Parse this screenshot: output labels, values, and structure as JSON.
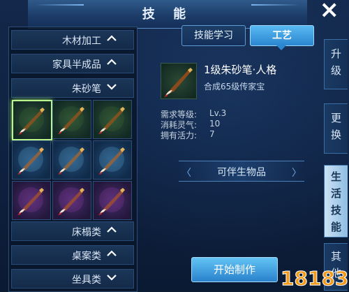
{
  "title": "技 能",
  "close_icon": "×",
  "left_list": {
    "categories": [
      {
        "label": "木材加工",
        "state": "collapsed"
      },
      {
        "label": "家具半成品",
        "state": "collapsed"
      },
      {
        "label": "朱砂笔",
        "state": "expanded"
      },
      {
        "label": "床榻类",
        "state": "collapsed"
      },
      {
        "label": "桌案类",
        "state": "collapsed"
      },
      {
        "label": "坐具类",
        "state": "collapsed"
      }
    ],
    "item_rows": [
      {
        "color": "green"
      },
      {
        "color": "blue"
      },
      {
        "color": "purple"
      }
    ]
  },
  "tabs": {
    "skill_learn": "技能学习",
    "craft": "工艺"
  },
  "item": {
    "name": "1级朱砂笔·人格",
    "subtitle": "合成65级传家宝"
  },
  "stats": [
    {
      "label": "需求等级:",
      "value": "Lv.3"
    },
    {
      "label": "消耗灵气:",
      "value": "10"
    },
    {
      "label": "拥有活力:",
      "value": "7"
    }
  ],
  "section_label": "可伴生物品",
  "start_button": "开始制作",
  "side_tabs": [
    {
      "label": [
        "升",
        "级"
      ],
      "active": false
    },
    {
      "label": [
        "更",
        "换"
      ],
      "active": false
    },
    {
      "label": [
        "生",
        "活",
        "技",
        "能"
      ],
      "active": true
    },
    {
      "label": [
        "其",
        "他"
      ],
      "active": false
    }
  ],
  "watermark": "18183",
  "colors": {
    "accent_blue": "#2c86d0",
    "selected_border": "#b9f48c",
    "watermark_orange": "#f39a1a"
  }
}
